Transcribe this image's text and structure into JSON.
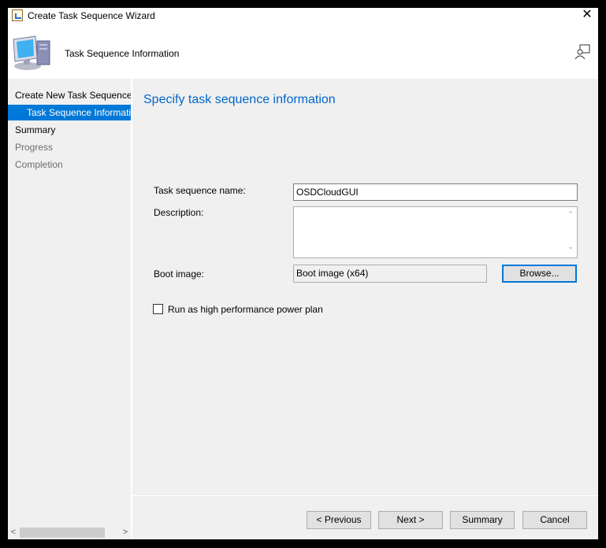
{
  "window": {
    "title": "Create Task Sequence Wizard",
    "close": "✕"
  },
  "header": {
    "title": "Task Sequence Information"
  },
  "sidebar": {
    "items": [
      {
        "label": "Create New Task Sequence",
        "state": "normal"
      },
      {
        "label": "Task Sequence Information",
        "state": "selected"
      },
      {
        "label": "Summary",
        "state": "normal"
      },
      {
        "label": "Progress",
        "state": "disabled"
      },
      {
        "label": "Completion",
        "state": "disabled"
      }
    ]
  },
  "main": {
    "heading": "Specify task sequence information",
    "name_label": "Task sequence name:",
    "name_value": "OSDCloudGUI",
    "description_label": "Description:",
    "description_value": "",
    "boot_label": "Boot image:",
    "boot_value": "Boot image (x64)",
    "browse": "Browse...",
    "high_perf_label": "Run as high performance power plan",
    "high_perf_checked": false
  },
  "footer": {
    "previous": "< Previous",
    "next": "Next >",
    "summary": "Summary",
    "cancel": "Cancel"
  },
  "colors": {
    "accent": "#0078d7",
    "heading": "#0066cc"
  }
}
